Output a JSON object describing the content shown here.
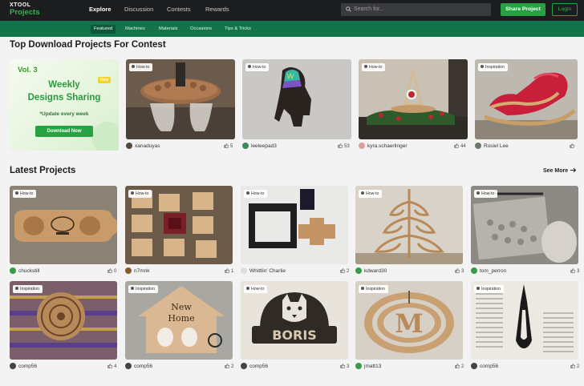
{
  "header": {
    "logo_top": "XTOOL",
    "logo_bottom": "Projects",
    "nav": [
      "Explore",
      "Discussion",
      "Contests",
      "Rewards"
    ],
    "search_placeholder": "Search for...",
    "share_label": "Share Project",
    "login_label": "Login"
  },
  "subnav": [
    "Featured",
    "Machines",
    "Materials",
    "Occasions",
    "Tips & Tricks"
  ],
  "top_section": {
    "title": "Top Download Projects For Contest",
    "promo": {
      "vol": "Vol. 3",
      "line1": "Weekly",
      "line2": "Designs Sharing",
      "badge": "New",
      "subtitle": "*Update every week",
      "button": "Download Now"
    },
    "cards": [
      {
        "tag": "How-to",
        "user": "xanaduyas",
        "likes": "5"
      },
      {
        "tag": "How-to",
        "user": "leeleepad3",
        "likes": "53"
      },
      {
        "tag": "How-to",
        "user": "kyra.schaerlinger",
        "likes": "44"
      },
      {
        "tag": "Inspiration",
        "user": "Rosiel Lee",
        "likes": ""
      }
    ]
  },
  "latest_section": {
    "title": "Latest Projects",
    "see_more": "See More",
    "cards": [
      {
        "tag": "How-to",
        "user": "chuckstill",
        "likes": "0"
      },
      {
        "tag": "How-to",
        "user": "n7mnk",
        "likes": "1"
      },
      {
        "tag": "How-to",
        "user": "Whittlin' Charlie",
        "likes": "2"
      },
      {
        "tag": "How-to",
        "user": "kdward30",
        "likes": "3"
      },
      {
        "tag": "How-to",
        "user": "tom_perron",
        "likes": "3"
      },
      {
        "tag": "Inspiration",
        "user": "comp56",
        "likes": "4"
      },
      {
        "tag": "Inspiration",
        "user": "comp56",
        "likes": "2"
      },
      {
        "tag": "How-to",
        "user": "comp56",
        "likes": "3"
      },
      {
        "tag": "Inspiration",
        "user": "jmatt13",
        "likes": "2"
      },
      {
        "tag": "Inspiration",
        "user": "comp56",
        "likes": "2"
      }
    ]
  },
  "image_text": {
    "home_sign_title1": "New",
    "home_sign_title2": "Home",
    "boris_sign": "BORIS",
    "monogram": "M"
  },
  "colors": {
    "topbar": "#1c1d1f",
    "subbar": "#13734a",
    "accent": "#27a243"
  }
}
